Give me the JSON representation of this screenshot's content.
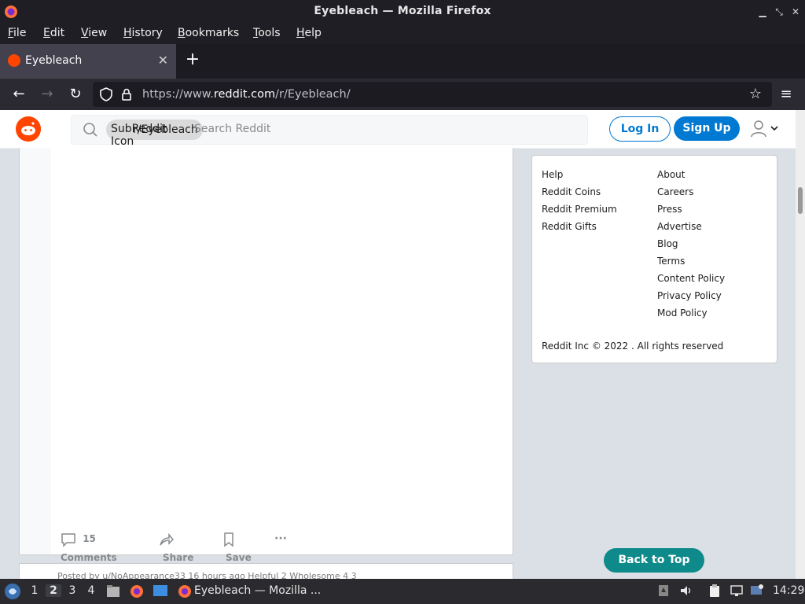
{
  "window": {
    "title": "Eyebleach — Mozilla Firefox",
    "controls": [
      "minimize",
      "restore",
      "close"
    ]
  },
  "menubar": {
    "items": [
      "File",
      "Edit",
      "View",
      "History",
      "Bookmarks",
      "Tools",
      "Help"
    ]
  },
  "tabs": [
    {
      "label": "Eyebleach",
      "active": true
    }
  ],
  "navbar": {
    "url_prefix": "https://www.",
    "url_domain": "reddit.com",
    "url_path": "/r/Eyebleach/"
  },
  "reddit_header": {
    "search_placeholder": "Search Reddit",
    "chip_label": "r/Eyebleach",
    "chip_alt_overlay": "SubReddit",
    "chip_alt_overlay2": "Icon",
    "login_label": "Log In",
    "signup_label": "Sign Up"
  },
  "post": {
    "comments_label": "15 Comments",
    "share_label": "Share",
    "save_label": "Save",
    "more_label": "···"
  },
  "next_post": {
    "meta": "Posted by u/NoAppearance33 16 hours ago  Helpful 2  Wholesome 4  3"
  },
  "sidebar": {
    "col1": [
      "Help",
      "Reddit Coins",
      "Reddit Premium",
      "Reddit Gifts"
    ],
    "col2": [
      "About",
      "Careers",
      "Press",
      "Advertise",
      "Blog",
      "Terms",
      "Content Policy",
      "Privacy Policy",
      "Mod Policy"
    ],
    "copyright": "Reddit Inc © 2022 . All rights reserved",
    "back_to_top": "Back to Top"
  },
  "taskbar": {
    "workspaces": [
      "1",
      "2",
      "3",
      "4"
    ],
    "active_workspace": "2",
    "task_label": "Eyebleach — Mozilla ...",
    "clock": "14:29"
  },
  "colors": {
    "reddit_orange": "#ff4500",
    "reddit_blue": "#0079d3",
    "back_to_top": "#0e8a8a"
  }
}
